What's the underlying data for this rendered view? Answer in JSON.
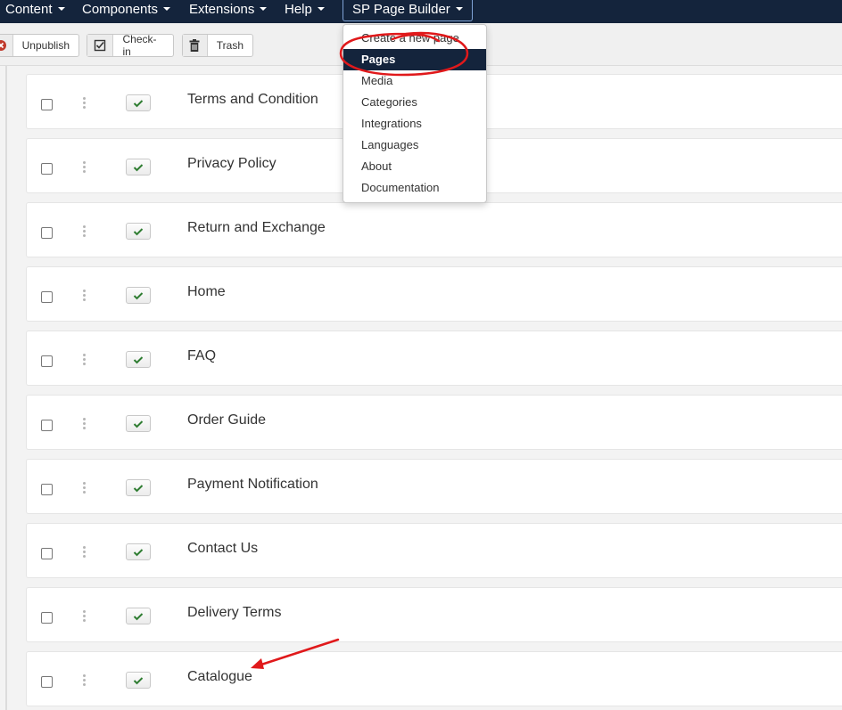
{
  "navbar": {
    "items": [
      {
        "label": "Content"
      },
      {
        "label": "Components"
      },
      {
        "label": "Extensions"
      },
      {
        "label": "Help"
      },
      {
        "label": "SP Page Builder"
      }
    ]
  },
  "toolbar": {
    "unpublish_label": "Unpublish",
    "checkin_label": "Check-in",
    "trash_label": "Trash"
  },
  "dropdown": {
    "items": [
      {
        "label": "Create a new page"
      },
      {
        "label": "Pages"
      },
      {
        "label": "Media"
      },
      {
        "label": "Categories"
      },
      {
        "label": "Integrations"
      },
      {
        "label": "Languages"
      },
      {
        "label": "About"
      },
      {
        "label": "Documentation"
      }
    ]
  },
  "pages": [
    {
      "title": "Terms and Condition"
    },
    {
      "title": "Privacy Policy"
    },
    {
      "title": "Return and Exchange"
    },
    {
      "title": "Home"
    },
    {
      "title": "FAQ"
    },
    {
      "title": "Order Guide"
    },
    {
      "title": "Payment Notification"
    },
    {
      "title": "Contact Us"
    },
    {
      "title": "Delivery Terms"
    },
    {
      "title": "Catalogue"
    }
  ],
  "colors": {
    "navbar": "#14243c",
    "active_item": "#14243c",
    "published_check": "#2f7d32",
    "annotation": "#e0191b"
  }
}
